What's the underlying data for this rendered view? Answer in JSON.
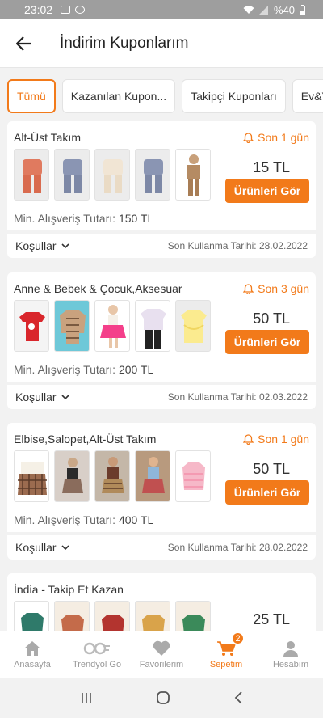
{
  "status_bar": {
    "time": "23:02",
    "battery": "%40"
  },
  "header": {
    "title": "İndirim Kuponlarım"
  },
  "filters": [
    "Tümü",
    "Kazanılan Kupon...",
    "Takipçi Kuponları",
    "Ev&Yaş"
  ],
  "coupons": [
    {
      "title": "Alt-Üst Takım",
      "time_left": "Son 1 gün",
      "amount": "15 TL",
      "button": "Ürünleri Gör",
      "min_label": "Min. Alışveriş Tutarı:",
      "min_value": "150 TL",
      "conditions": "Koşullar",
      "expiry": "Son Kullanma Tarihi: 28.02.2022"
    },
    {
      "title": "Anne & Bebek & Çocuk,Aksesuar",
      "time_left": "Son 3 gün",
      "amount": "50 TL",
      "button": "Ürünleri Gör",
      "min_label": "Min. Alışveriş Tutarı:",
      "min_value": "200 TL",
      "conditions": "Koşullar",
      "expiry": "Son Kullanma Tarihi: 02.03.2022"
    },
    {
      "title": "Elbise,Salopet,Alt-Üst Takım",
      "time_left": "Son 1 gün",
      "amount": "50 TL",
      "button": "Ürünleri Gör",
      "min_label": "Min. Alışveriş Tutarı:",
      "min_value": "400 TL",
      "conditions": "Koşullar",
      "expiry": "Son Kullanma Tarihi: 28.02.2022"
    },
    {
      "title": "İndia  - Takip Et Kazan",
      "amount": "25 TL"
    }
  ],
  "nav": {
    "items": [
      "Anasayfa",
      "Trendyol Go",
      "Favorilerim",
      "Sepetim",
      "Hesabım"
    ],
    "cart_badge": "2"
  },
  "colors": {
    "accent": "#f27a1a"
  }
}
